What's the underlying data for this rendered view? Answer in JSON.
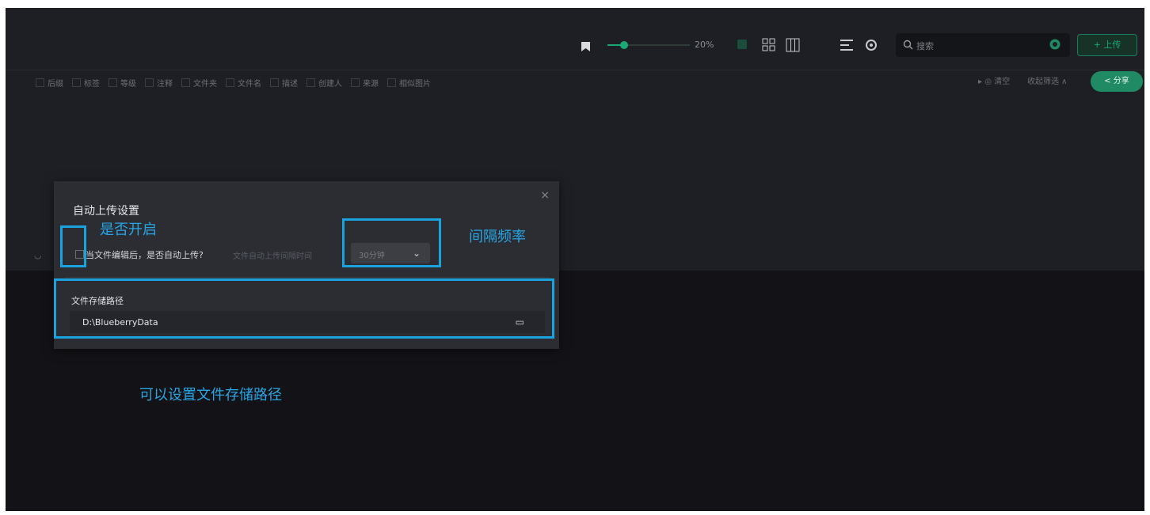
{
  "toolbar": {
    "zoom": "20%",
    "zoom_level": 0.2,
    "search_placeholder": "搜索",
    "upload_label": "+ 上传",
    "icons": [
      "bookmark-icon",
      "grid-icon",
      "columns-icon",
      "list-icon",
      "settings-icon",
      "search-icon",
      "sync-icon"
    ]
  },
  "filters": {
    "items": [
      "后缀",
      "标签",
      "等级",
      "注释",
      "文件夹",
      "文件名",
      "描述",
      "创建人",
      "来源",
      "相似图片"
    ],
    "clear_label": "▸ ◎ 清空",
    "more_label": "收起筛选 ∧",
    "share_label": "< 分享"
  },
  "dialog": {
    "title": "自动上传设置",
    "close": "×",
    "enable_question": "当文件编辑后，是否自动上传?",
    "hint": "文件自动上传间隔时间",
    "interval_value": "30分钟",
    "path_label": "文件存储路径",
    "path_value": "D:\\BlueberryData"
  },
  "annotations": {
    "enable": "是否开启",
    "interval": "间隔频率",
    "path": "可以设置文件存储路径"
  },
  "colors": {
    "accent": "#1aa874",
    "annotation": "#1aa3df",
    "background": "#1e1f24"
  }
}
